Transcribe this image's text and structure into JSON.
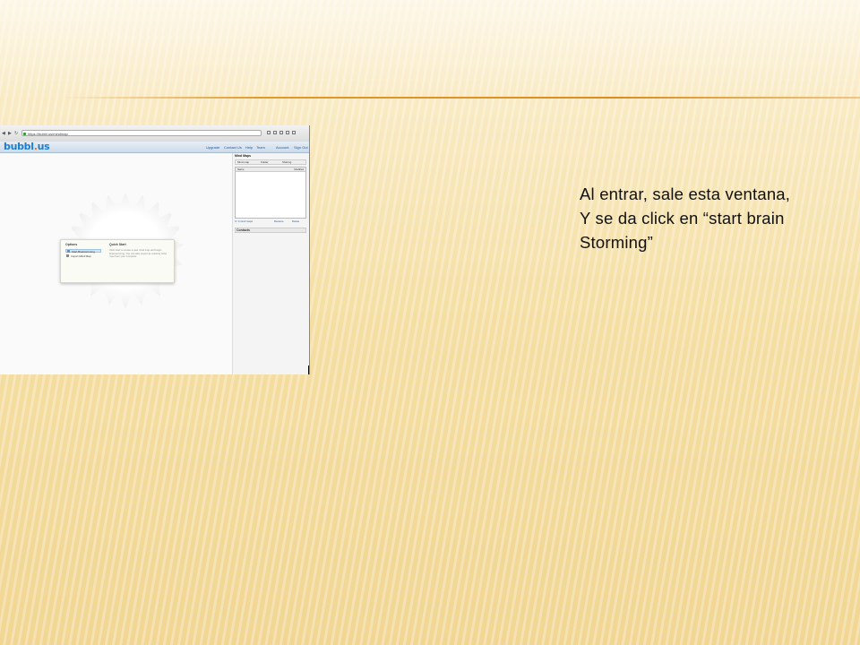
{
  "caption": {
    "lines": [
      "Al entrar, sale esta ventana,",
      "Y se da click en “start brain",
      "Storming”"
    ]
  },
  "screenshot": {
    "browser": {
      "url": "https://bubbl.us/mindmap"
    },
    "app": {
      "logo_main": "bubbl",
      "logo_dot": ".",
      "logo_end": "us",
      "menu": [
        "Upgrade",
        "Contact Us",
        "Help",
        "Team",
        "Account",
        "Sign Out"
      ]
    },
    "dialog": {
      "options_heading": "Options",
      "options": [
        "Start Brainstorming",
        "Import Mind Map"
      ],
      "description_heading": "Quick Start",
      "description": "Click start to create a new mind map and begin brainstorming. You can also import an existing mind map from your computer."
    },
    "panel": {
      "title": "Mind Maps",
      "tools": [
        "Mind map",
        "Folder",
        "Sharing"
      ],
      "columns": [
        "Name",
        "Modified"
      ],
      "footer_left": "0 / 3 mind maps",
      "footer_actions": [
        "Rename",
        "Delete"
      ],
      "contacts_title": "Contacts"
    }
  },
  "colors": {
    "accent_rule": "#e09a2e",
    "logo": "#1a7ed1",
    "logo_dot": "#e8731e"
  }
}
